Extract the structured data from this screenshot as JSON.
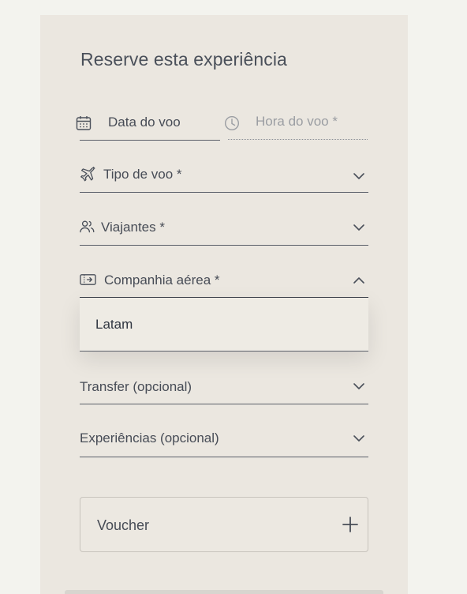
{
  "booking": {
    "title": "Reserve esta experiência",
    "flight_date": {
      "label": "Data do voo",
      "icon": "calendar-icon"
    },
    "flight_time": {
      "placeholder": "Hora do voo *",
      "icon": "clock-icon"
    },
    "flight_type": {
      "label": "Tipo de voo *",
      "icon": "plane-icon"
    },
    "travelers": {
      "label": "Viajantes *",
      "icon": "users-icon"
    },
    "airline": {
      "label": "Companhia aérea *",
      "icon": "ticket-icon",
      "expanded": true,
      "options": [
        "Latam"
      ]
    },
    "transfer": {
      "label": "Transfer (opcional)"
    },
    "experiences": {
      "label": "Experiências (opcional)"
    },
    "voucher": {
      "label": "Voucher",
      "icon": "plus-icon"
    }
  },
  "colors": {
    "page_bg": "#f3f3ee",
    "card_bg": "#ebe7e0",
    "text": "#474c56",
    "muted": "#9a9da2",
    "line": "#5b606a"
  }
}
